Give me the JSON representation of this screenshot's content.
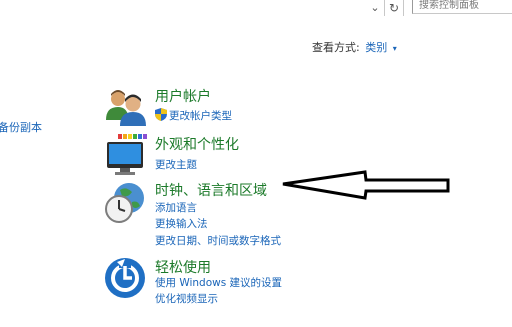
{
  "address_bar": {
    "chevron": "⌄",
    "refresh": "↻",
    "search_placeholder": "搜索控制面板"
  },
  "view_by": {
    "label": "查看方式:",
    "value": "类别",
    "caret": "▾"
  },
  "left_partial_link": "备份副本",
  "categories": [
    {
      "icon": "users-icon",
      "title": "用户帐户",
      "links": [
        "更改帐户类型"
      ]
    },
    {
      "icon": "appearance-icon",
      "title": "外观和个性化",
      "links": [
        "更改主题"
      ]
    },
    {
      "icon": "clock-globe-icon",
      "title": "时钟、语言和区域",
      "links": [
        "添加语言",
        "更换输入法",
        "更改日期、时间或数字格式"
      ]
    },
    {
      "icon": "ease-of-access-icon",
      "title": "轻松使用",
      "links": [
        "使用 Windows 建议的设置",
        "优化视频显示"
      ]
    }
  ],
  "colors": {
    "link": "#1a65b8",
    "category_title": "#1c7a2a",
    "arrow": "#000000"
  }
}
